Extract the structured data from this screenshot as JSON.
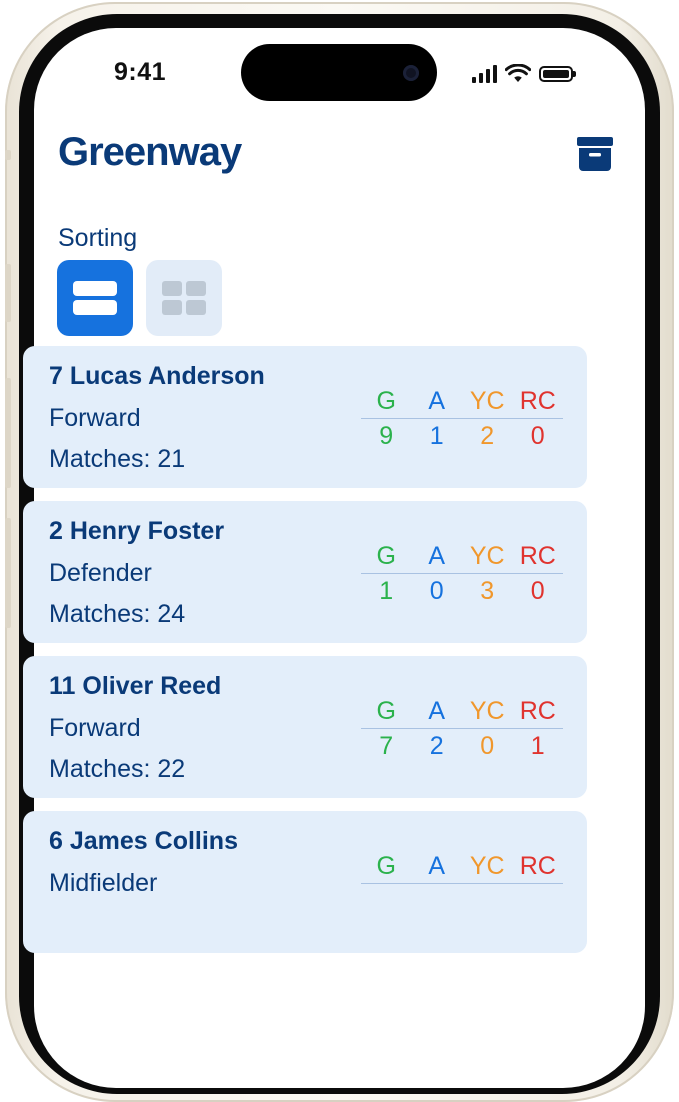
{
  "status_bar": {
    "time": "9:41"
  },
  "app": {
    "title": "Greenway"
  },
  "sorting": {
    "label": "Sorting"
  },
  "stat_headers": {
    "goals": "G",
    "assists": "A",
    "yellow_cards": "YC",
    "red_cards": "RC"
  },
  "players": [
    {
      "name": "7 Lucas Anderson",
      "position": "Forward",
      "matches": "Matches: 21",
      "goals": "9",
      "assists": "1",
      "yellow_cards": "2",
      "red_cards": "0"
    },
    {
      "name": "2 Henry Foster",
      "position": "Defender",
      "matches": "Matches: 24",
      "goals": "1",
      "assists": "0",
      "yellow_cards": "3",
      "red_cards": "0"
    },
    {
      "name": "11 Oliver Reed",
      "position": "Forward",
      "matches": "Matches: 22",
      "goals": "7",
      "assists": "2",
      "yellow_cards": "0",
      "red_cards": "1"
    },
    {
      "name": "6 James Collins",
      "position": "Midfielder",
      "matches": "",
      "goals": "",
      "assists": "",
      "yellow_cards": "",
      "red_cards": ""
    }
  ],
  "colors": {
    "primary": "#0a3a78",
    "accent": "#1672de",
    "card_bg": "#e3eefa",
    "goals": "#2bb24c",
    "assists": "#1672de",
    "yellow_cards": "#f0972c",
    "red_cards": "#e0332e"
  },
  "icons": {
    "archive": "archive-box-icon",
    "list_view": "list-view-icon",
    "grid_view": "grid-view-icon"
  }
}
